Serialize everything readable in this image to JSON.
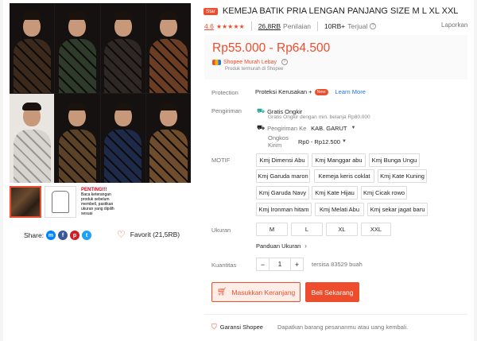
{
  "colors": {
    "accent": "#ee4d2d",
    "teal": "#26aa99",
    "link": "#2673dd",
    "price_bg": "#fafafa"
  },
  "gallery": {
    "shirt_colors": [
      "#3b2a1c",
      "#2f3b2a",
      "#2e2724",
      "#6b3d22",
      "#d7d4d0",
      "#5b4226",
      "#1e2a4a",
      "#6e4c2c"
    ],
    "thumb_notice": {
      "title": "PENTING!!!",
      "text": "Baca keterangan produk sebelum membeli, pastikan ukuran yang dipilih sesuai"
    }
  },
  "share": {
    "label": "Share:",
    "icons": [
      "messenger-icon",
      "facebook-icon",
      "pinterest-icon",
      "twitter-icon"
    ]
  },
  "favorite": {
    "label": "Favorit (21,5RB)"
  },
  "product": {
    "badge": "Star",
    "title": "KEMEJA BATIK PRIA LENGAN PANJANG SIZE M L XL XXL",
    "rating": "4.6",
    "stars": "★★★★★",
    "ratings_count": "26,8RB",
    "ratings_label": "Penilaian",
    "sold_count": "10RB+",
    "sold_label": "Terjual",
    "report": "Laporkan",
    "price": "Rp55.000 - Rp64.500",
    "mall_text": "Shopee Murah Lebay",
    "mall_sub": "Produk termurah di Shopee"
  },
  "protection": {
    "label": "Protection",
    "text": "Proteksi Kerusakan +",
    "badge": "New",
    "link": "Learn More"
  },
  "shipping": {
    "label": "Pengiriman",
    "free": "Gratis Ongkir",
    "free_sub": "Gratis Ongkir dengan min. belanja Rp80.000",
    "to_label": "Pengiriman Ke",
    "to_value": "KAB. GARUT",
    "cost_label": "Ongkos Kirim",
    "cost_value": "Rp0 - Rp12.500"
  },
  "motif": {
    "label": "MOTIF",
    "options": [
      "Kmj Dimensi Abu",
      "Kmj Manggar abu",
      "Kmj Bunga Ungu",
      "Kmj Garuda maron",
      "Kemeja keris coklat",
      "Kmj Kate Kuning",
      "Kmj Garuda Navy",
      "Kmj Kate Hijau",
      "Kmj Cicak rowo",
      "Kmj Ironman hitam",
      "Kmj Melati Abu",
      "Kmj sekar jagat baru"
    ]
  },
  "size": {
    "label": "Ukuran",
    "options": [
      "M",
      "L",
      "XL",
      "XXL"
    ],
    "guide": "Panduan Ukuran"
  },
  "quantity": {
    "label": "Kuantitas",
    "value": "1",
    "stock": "tersisa 83529 buah"
  },
  "actions": {
    "cart": "Masukkan Keranjang",
    "buy": "Beli Sekarang"
  },
  "guarantee": {
    "label": "Garansi Shopee",
    "desc": "Dapatkan barang pesananmu atau uang kembali."
  }
}
